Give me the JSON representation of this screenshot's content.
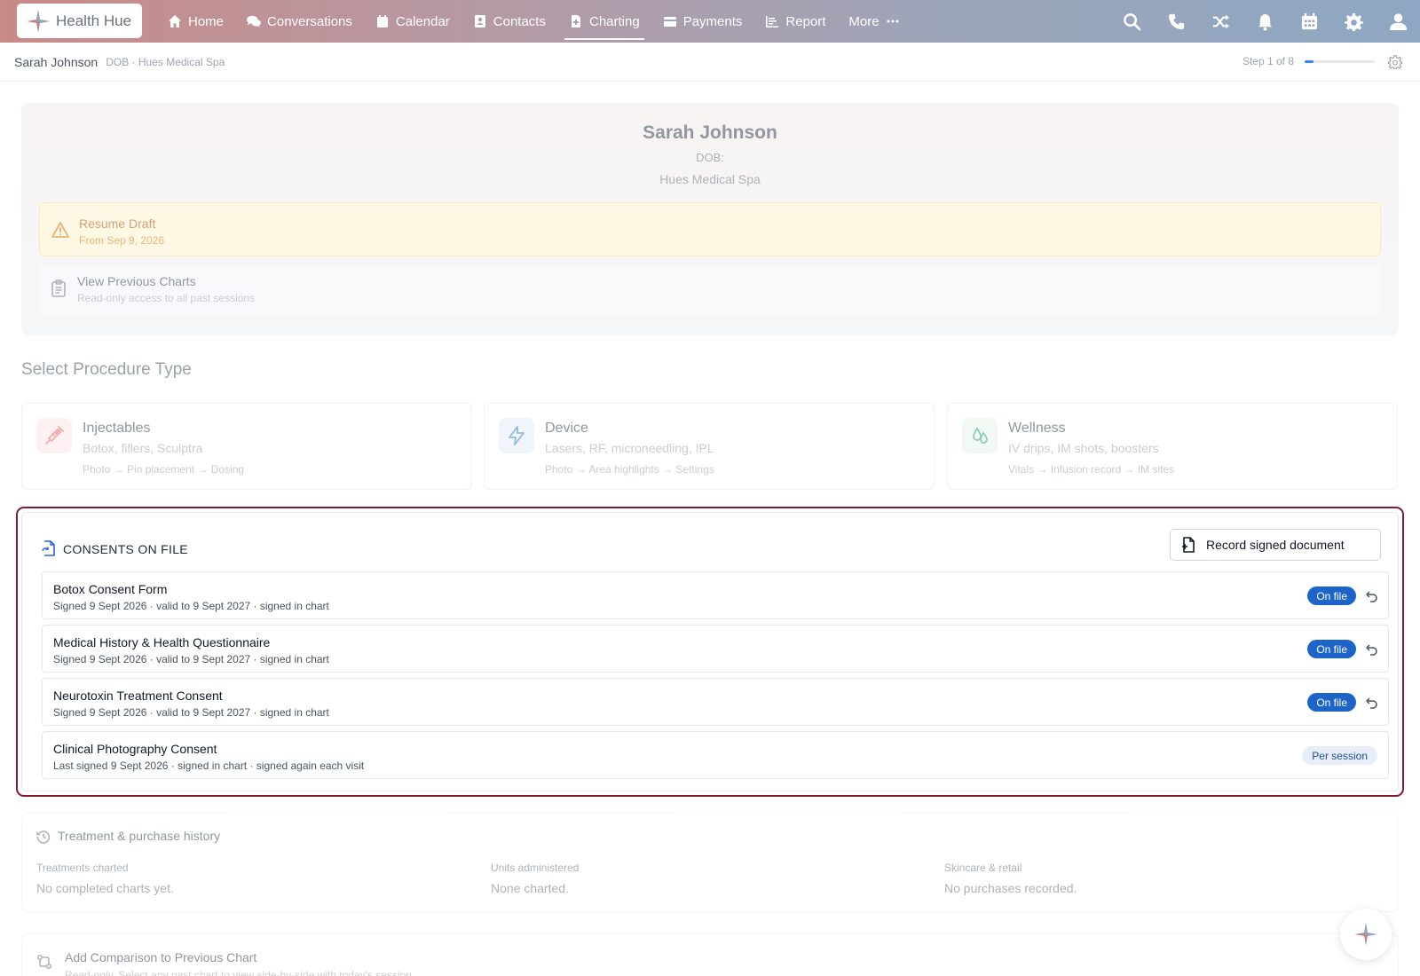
{
  "brand": {
    "name": "Health Hue"
  },
  "nav": {
    "items": [
      {
        "label": "Home",
        "icon": "home-icon"
      },
      {
        "label": "Conversations",
        "icon": "chat-icon"
      },
      {
        "label": "Calendar",
        "icon": "calendar-icon"
      },
      {
        "label": "Contacts",
        "icon": "contact-icon"
      },
      {
        "label": "Charting",
        "icon": "document-icon",
        "active": true
      },
      {
        "label": "Payments",
        "icon": "card-icon"
      },
      {
        "label": "Report",
        "icon": "report-icon"
      },
      {
        "label": "More",
        "icon": "ellipsis-icon"
      }
    ],
    "right_icons": [
      "search-icon",
      "phone-icon",
      "shuffle-icon",
      "bell-icon",
      "calendar-grid-icon",
      "gear-icon",
      "user-icon"
    ]
  },
  "subheader": {
    "patient_name": "Sarah Johnson",
    "meta": "DOB · Hues Medical Spa",
    "step_text": "Step 1 of 8",
    "step_progress": 0.125
  },
  "patient": {
    "name": "Sarah Johnson",
    "dob": "DOB:",
    "org": "Hues Medical Spa"
  },
  "draft": {
    "title": "Resume Draft",
    "subtitle": "From Sep 9, 2026"
  },
  "previous": {
    "title": "View Previous Charts",
    "subtitle": "Read-only access to all past sessions"
  },
  "procedure_section": {
    "title": "Select Procedure Type",
    "cards": [
      {
        "title": "Injectables",
        "subtitle": "Botox, fillers, Sculptra",
        "flow": "Photo → Pin placement → Dosing",
        "icon": "syringe-icon",
        "color": "#e06a6a"
      },
      {
        "title": "Device",
        "subtitle": "Lasers, RF, microneedling, IPL",
        "flow": "Photo → Area highlights → Settings",
        "icon": "lightning-icon",
        "color": "#3b82c4"
      },
      {
        "title": "Wellness",
        "subtitle": "IV drips, IM shots, boosters",
        "flow": "Vitals → Infusion record → IM sites",
        "icon": "droplet-icon",
        "color": "#2fa37a"
      }
    ]
  },
  "consents": {
    "heading": "CONSENTS ON FILE",
    "record_button": "Record signed document",
    "rows": [
      {
        "name": "Botox Consent Form",
        "meta": "Signed 9 Sept 2026 · valid to 9 Sept 2027 · signed in chart",
        "status": "On file"
      },
      {
        "name": "Medical History & Health Questionnaire",
        "meta": "Signed 9 Sept 2026 · valid to 9 Sept 2027 · signed in chart",
        "status": "On file"
      },
      {
        "name": "Neurotoxin Treatment Consent",
        "meta": "Signed 9 Sept 2026 · valid to 9 Sept 2027 · signed in chart",
        "status": "On file"
      },
      {
        "name": "Clinical Photography Consent",
        "meta": "Last signed 9 Sept 2026 · signed in chart · signed again each visit",
        "status": "Per session"
      }
    ]
  },
  "history": {
    "title": "Treatment & purchase history",
    "columns": [
      {
        "label": "Treatments charted",
        "value": "No completed charts yet."
      },
      {
        "label": "Units administered",
        "value": "None charted."
      },
      {
        "label": "Skincare & retail",
        "value": "No purchases recorded."
      }
    ]
  },
  "comparison": {
    "title": "Add Comparison to Previous Chart",
    "subtitle": "Read-only. Select any past chart to view side-by-side with today's session."
  }
}
